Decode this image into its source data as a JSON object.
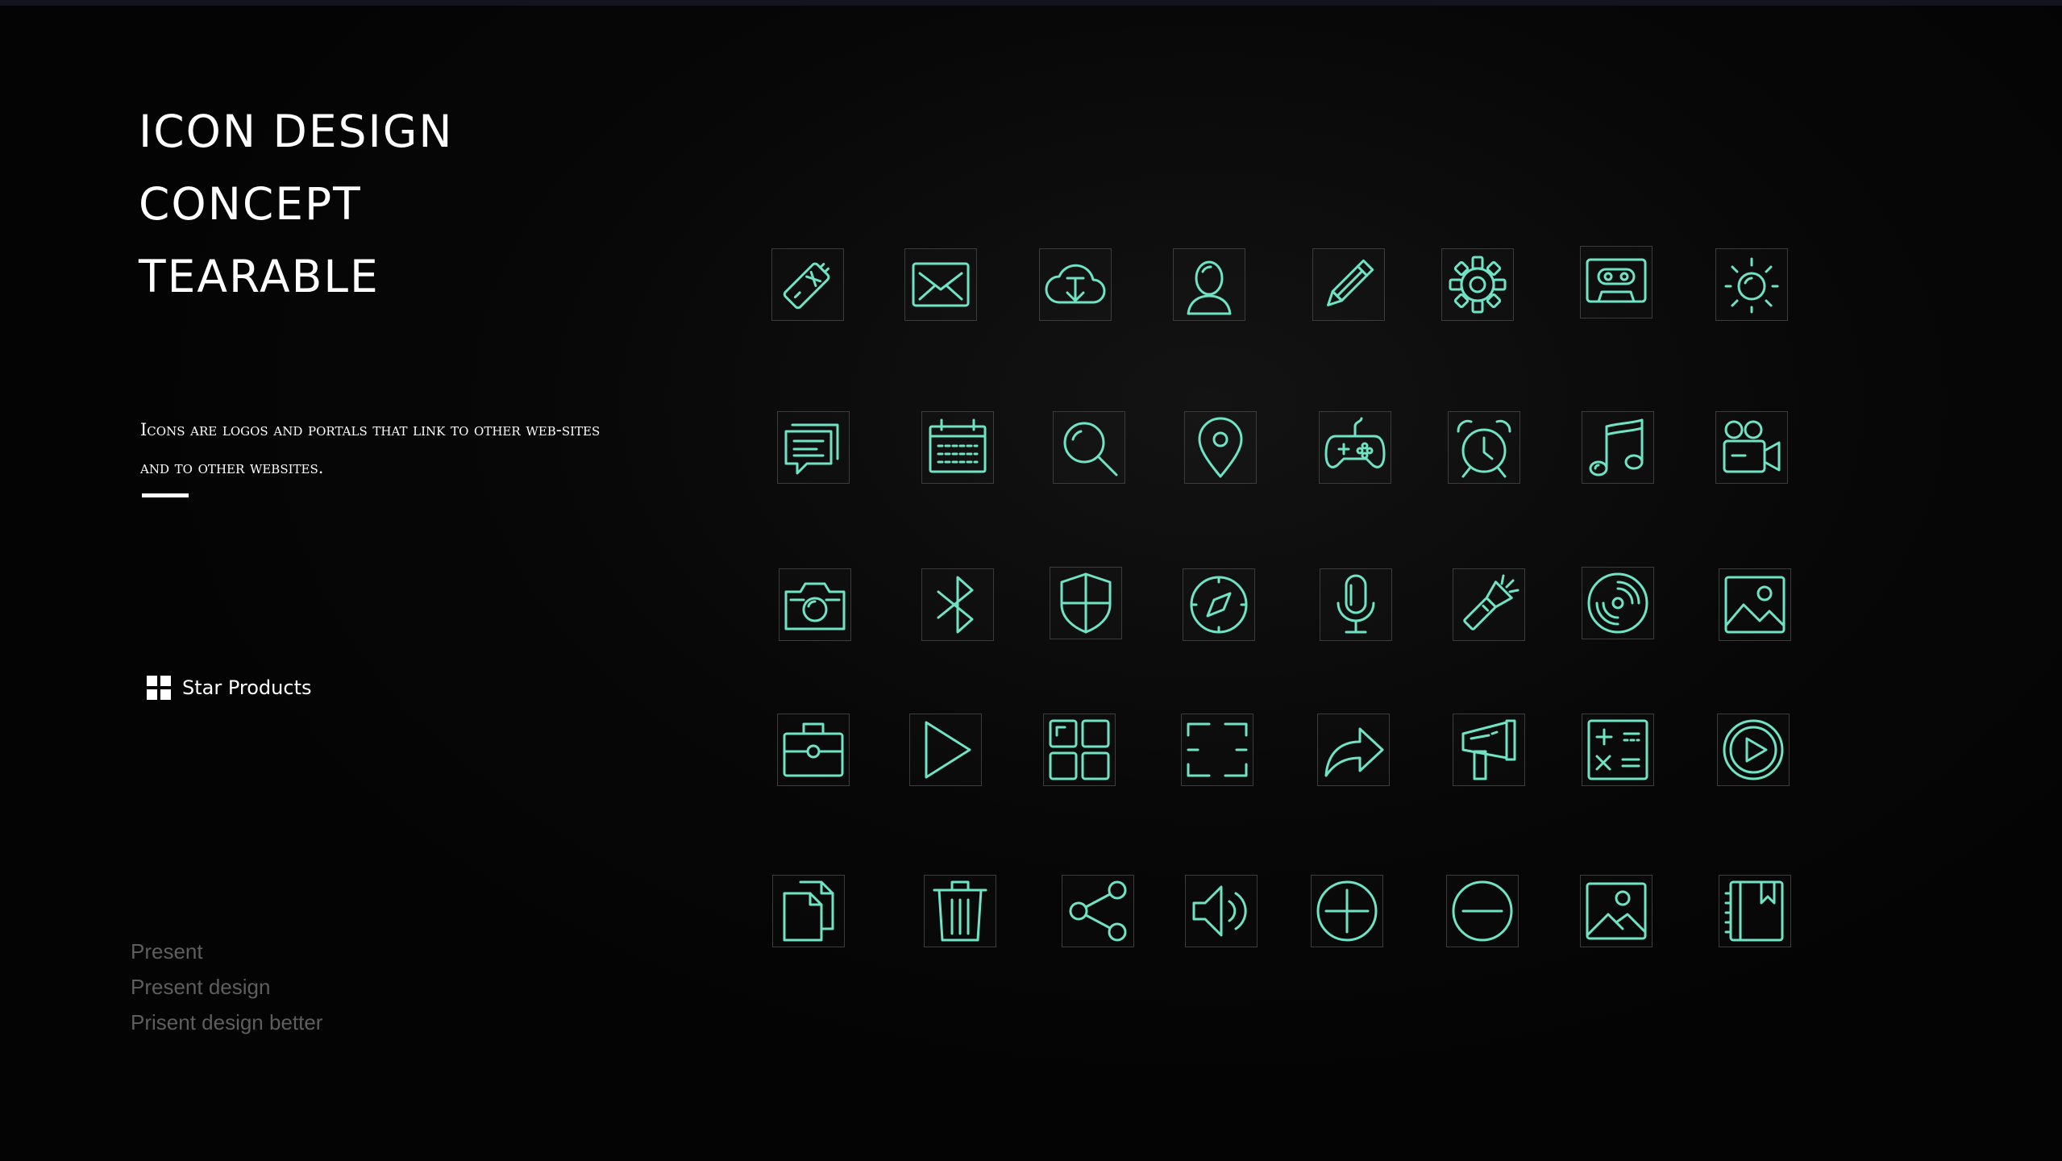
{
  "slide": {
    "title_lines": [
      "ICON DESIGN",
      "CONCEPT",
      "TEARABLE"
    ],
    "description": "Icons are logos and portals that link to other web-sites and to other websites.",
    "star_products": "Star Products",
    "present_lines": [
      "Present",
      "Present design",
      "Prisent design better"
    ]
  },
  "icon_accent_color": "#6fe3c4",
  "icon_rows": [
    [
      "battery-icon",
      "mail-icon",
      "cloud-download-icon",
      "user-icon",
      "pencil-icon",
      "gear-icon",
      "cassette-icon",
      "brightness-icon"
    ],
    [
      "chat-icon",
      "calendar-icon",
      "search-icon",
      "location-pin-icon",
      "gamepad-icon",
      "alarm-clock-icon",
      "music-note-icon",
      "video-camera-icon"
    ],
    [
      "camera-icon",
      "bluetooth-icon",
      "shield-icon",
      "compass-icon",
      "microphone-icon",
      "flashlight-icon",
      "vinyl-disc-icon",
      "image-icon"
    ],
    [
      "briefcase-icon",
      "play-icon",
      "apps-grid-icon",
      "scan-frame-icon",
      "share-arrow-icon",
      "megaphone-icon",
      "calculator-icon",
      "play-circle-icon"
    ],
    [
      "documents-icon",
      "trash-icon",
      "share-nodes-icon",
      "speaker-icon",
      "plus-circle-icon",
      "minus-circle-icon",
      "picture-icon",
      "bookmark-book-icon"
    ]
  ]
}
